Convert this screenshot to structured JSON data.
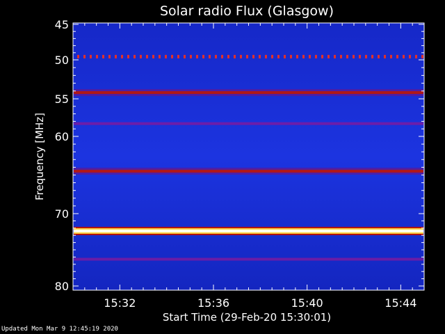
{
  "chart_data": {
    "type": "heatmap",
    "title": "Solar radio Flux (Glasgow)",
    "xlabel": "Start Time (29-Feb-20 15:30:01)",
    "ylabel": "Frequency [MHz]",
    "x_ticks": [
      "15:32",
      "15:36",
      "15:40",
      "15:44"
    ],
    "x_tick_minutes": [
      2,
      6,
      10,
      14
    ],
    "xlim_minutes": [
      0,
      15
    ],
    "y_ticks": [
      45,
      50,
      55,
      60,
      70,
      80
    ],
    "ylim": [
      45,
      80
    ],
    "background_color": "#1a2fd8",
    "emission_bands": [
      {
        "freq": 49.5,
        "intensity": "medium",
        "pattern": "dotted"
      },
      {
        "freq": 54.2,
        "intensity": "medium"
      },
      {
        "freq": 58.3,
        "intensity": "low"
      },
      {
        "freq": 64.5,
        "intensity": "medium"
      },
      {
        "freq": 72.4,
        "intensity": "high"
      },
      {
        "freq": 76.3,
        "intensity": "low"
      }
    ]
  },
  "footer": "Updated Mon Mar  9 12:45:19 2020"
}
